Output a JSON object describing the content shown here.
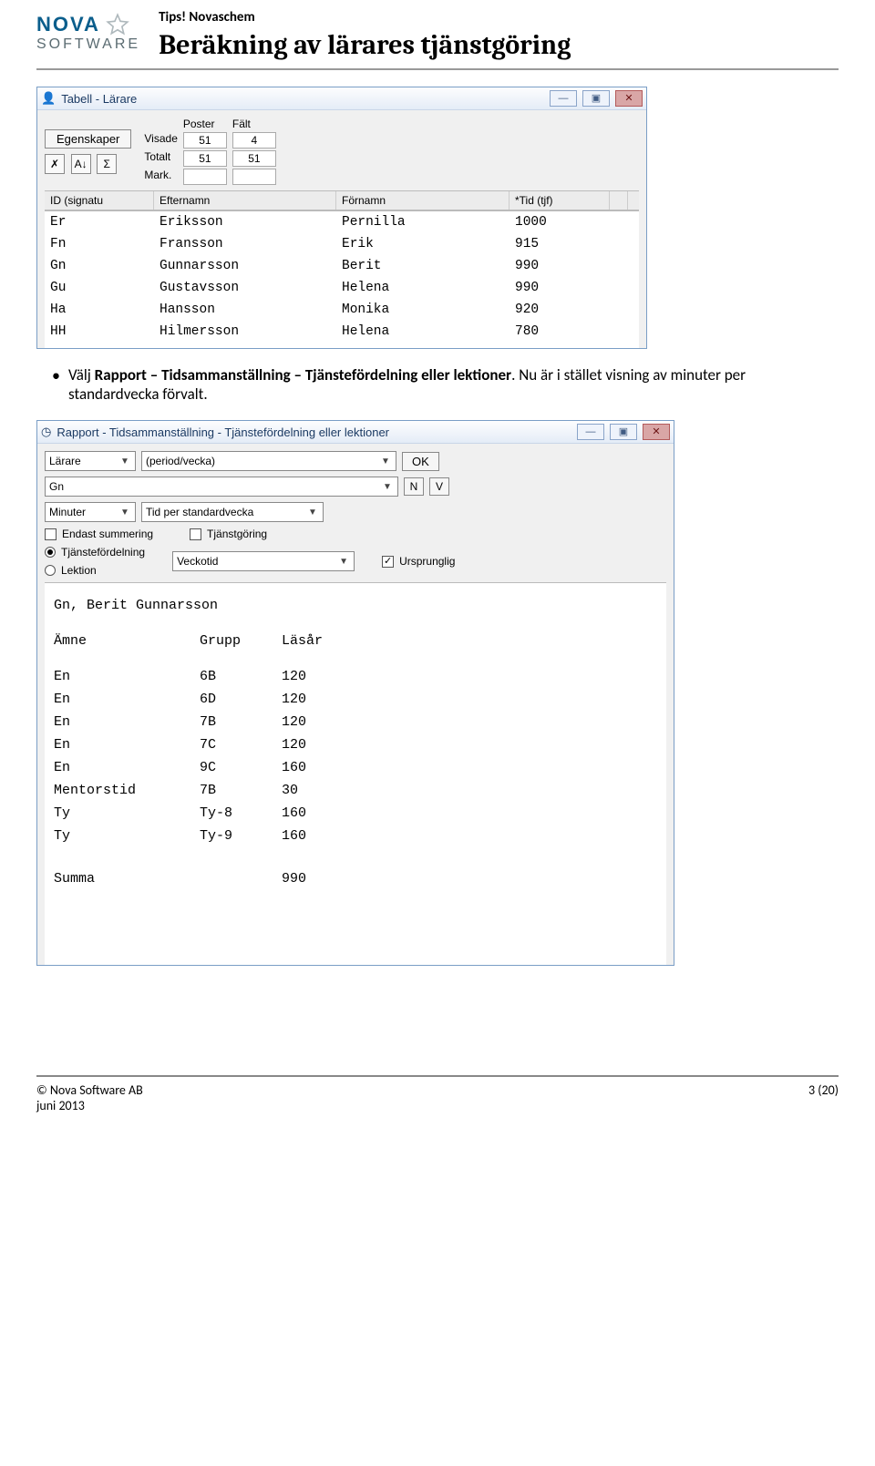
{
  "header": {
    "tips": "Tips! Novaschem",
    "title": "Beräkning av lärares tjänstgöring",
    "logo_line1": "NOVA",
    "logo_line2": "SOFTWARE"
  },
  "window1": {
    "title": "Tabell - Lärare",
    "btn_egenskaper": "Egenskaper",
    "poster_header1": "Poster",
    "poster_header2": "Fält",
    "rows_labels": {
      "visade": "Visade",
      "totalt": "Totalt",
      "mark": "Mark."
    },
    "poster_values": {
      "visade_poster": "51",
      "visade_falt": "4",
      "totalt_poster": "51",
      "totalt_falt": "51",
      "mark_poster": "",
      "mark_falt": ""
    },
    "columns": [
      "ID (signatu",
      "Efternamn",
      "Förnamn",
      "*Tid (tjf)"
    ],
    "teachers": [
      {
        "id": "Er",
        "efternamn": "Eriksson",
        "fornamn": "Pernilla",
        "tid": "1000"
      },
      {
        "id": "Fn",
        "efternamn": "Fransson",
        "fornamn": "Erik",
        "tid": "915"
      },
      {
        "id": "Gn",
        "efternamn": "Gunnarsson",
        "fornamn": "Berit",
        "tid": "990"
      },
      {
        "id": "Gu",
        "efternamn": "Gustavsson",
        "fornamn": "Helena",
        "tid": "990"
      },
      {
        "id": "Ha",
        "efternamn": "Hansson",
        "fornamn": "Monika",
        "tid": "920"
      },
      {
        "id": "HH",
        "efternamn": "Hilmersson",
        "fornamn": "Helena",
        "tid": "780"
      }
    ]
  },
  "body_text": {
    "line1_pre": "Välj ",
    "line1_bold": "Rapport – Tidsammanställning – Tjänstefördelning eller lektioner",
    "line1_post": ". Nu är i stället visning av minuter per standardvecka förvalt."
  },
  "window2": {
    "title": "Rapport - Tidsammanställning - Tjänstefördelning eller lektioner",
    "sel_larare": "Lärare",
    "sel_period": "(period/vecka)",
    "btn_ok": "OK",
    "sel_gn": "Gn",
    "btn_n": "N",
    "btn_v": "V",
    "sel_minuter": "Minuter",
    "sel_tidper": "Tid per standardvecka",
    "chk_endast": "Endast summering",
    "chk_tjanst": "Tjänstgöring",
    "radio_tjf": "Tjänstefördelning",
    "radio_lek": "Lektion",
    "sel_veckotid": "Veckotid",
    "chk_urspr": "Ursprunglig",
    "report": {
      "header_name": "Gn, Berit Gunnarsson",
      "cols": {
        "amne": "Ämne",
        "grupp": "Grupp",
        "lasar": "Läsår"
      },
      "rows": [
        {
          "amne": "En",
          "grupp": "6B",
          "lasar": "120"
        },
        {
          "amne": "En",
          "grupp": "6D",
          "lasar": "120"
        },
        {
          "amne": "En",
          "grupp": "7B",
          "lasar": "120"
        },
        {
          "amne": "En",
          "grupp": "7C",
          "lasar": "120"
        },
        {
          "amne": "En",
          "grupp": "9C",
          "lasar": "160"
        },
        {
          "amne": "Mentorstid",
          "grupp": "7B",
          "lasar": "30"
        },
        {
          "amne": "Ty",
          "grupp": "Ty-8",
          "lasar": "160"
        },
        {
          "amne": "Ty",
          "grupp": "Ty-9",
          "lasar": "160"
        }
      ],
      "summa_label": "Summa",
      "summa_value": "990"
    }
  },
  "footer": {
    "left1": "© Nova Software AB",
    "left2": "juni 2013",
    "right": "3 (20)"
  }
}
